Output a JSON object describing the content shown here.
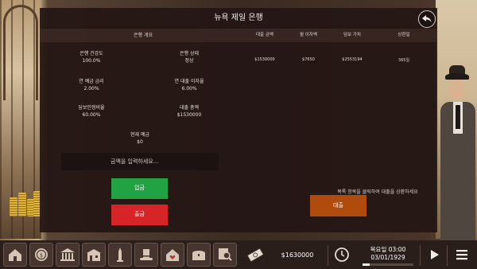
{
  "panel": {
    "title": "뉴욕 제일 은행"
  },
  "overview": {
    "header": "은행 개요",
    "stats": [
      {
        "label": "은행 건강도",
        "value": "100.0%"
      },
      {
        "label": "은행 상태",
        "value": "정상"
      },
      {
        "label": "연 예금 금리",
        "value": "2.00%"
      },
      {
        "label": "연 대출 이자율",
        "value": "6.00%"
      },
      {
        "label": "담보인정비율",
        "value": "60.00%"
      },
      {
        "label": "대출 총액",
        "value": "$1530000"
      },
      {
        "label": "현재 예금",
        "value": "$0"
      }
    ]
  },
  "loans": {
    "columns": [
      "대출 금액",
      "월 이자액",
      "담보 가치",
      "상환일"
    ],
    "rows": [
      [
        "$1530000",
        "$7650",
        "$2553194",
        "365일"
      ]
    ],
    "hint": "목록 항목을 클릭하여 대출을 상환하세요"
  },
  "actions": {
    "amount_placeholder": "금액을 입력하세요...",
    "deposit_label": "입금",
    "withdraw_label": "출금",
    "loan_label": "대출"
  },
  "toolbar": {
    "money": "$1630000",
    "day": "목요일 03:00",
    "date": "03/01/1929",
    "day_progress": 0.14
  },
  "colors": {
    "deposit": "#21a344",
    "withdraw": "#d72429",
    "loan": "#b04b0e",
    "panel": "#241614"
  },
  "icons": [
    "home-icon",
    "coin-icon",
    "bank-icon",
    "bank-office-icon",
    "tower-icon",
    "top-hat-icon",
    "house-heart-icon",
    "treasure-chest-icon",
    "magnifier-icon",
    "cash-stack-icon",
    "clock-icon",
    "play-icon",
    "menu-icon",
    "back-arrow-icon"
  ]
}
